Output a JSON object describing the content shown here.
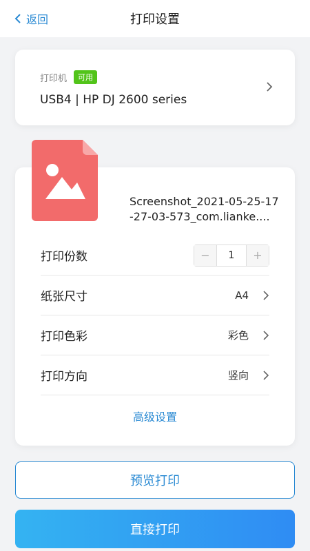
{
  "header": {
    "back_label": "返回",
    "title": "打印设置"
  },
  "printer": {
    "label": "打印机",
    "status_badge": "可用",
    "name": "USB4 | HP DJ 2600 series"
  },
  "file": {
    "icon": "image-file-icon",
    "name": "Screenshot_2021-05-25-17-27-03-573_com.lianke...."
  },
  "settings": {
    "copies_label": "打印份数",
    "copies_value": "1",
    "decrement_symbol": "−",
    "increment_symbol": "+",
    "paper_size_label": "纸张尺寸",
    "paper_size_value": "A4",
    "color_label": "打印色彩",
    "color_value": "彩色",
    "orientation_label": "打印方向",
    "orientation_value": "竖向",
    "advanced_label": "高级设置"
  },
  "actions": {
    "preview_label": "预览打印",
    "print_label": "直接打印"
  },
  "colors": {
    "accent": "#2a8ad3",
    "badge_green": "#52c41a",
    "file_icon_red": "#f26b6b"
  }
}
